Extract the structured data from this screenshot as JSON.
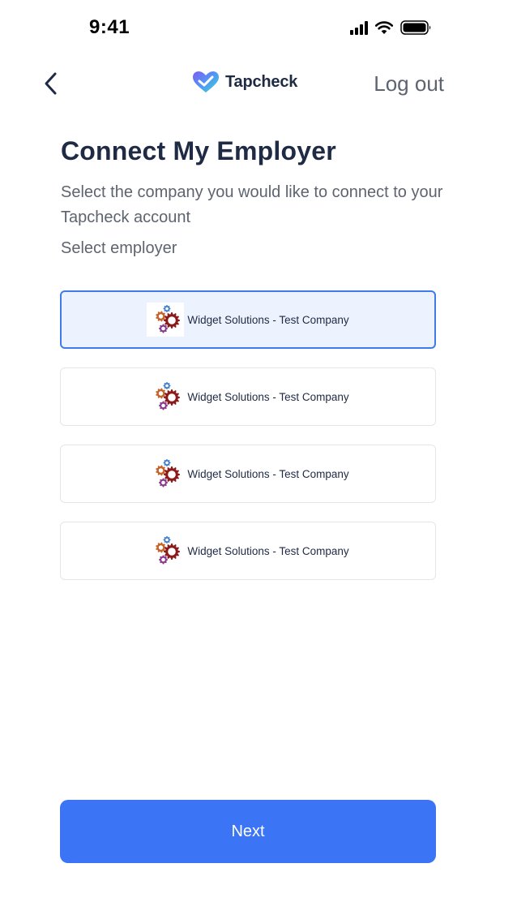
{
  "status_bar": {
    "time": "9:41",
    "icons": [
      "signal-icon",
      "wifi-icon",
      "battery-icon"
    ]
  },
  "nav": {
    "back_icon": "chevron-left-icon",
    "brand_name": "Tapcheck",
    "logout_label": "Log out"
  },
  "page": {
    "title": "Connect My Employer",
    "subtitle": "Select the company you would like to connect to your Tapcheck account",
    "select_label": "Select employer"
  },
  "employers": [
    {
      "name": "Widget Solutions - Test Company",
      "selected": true
    },
    {
      "name": "Widget Solutions - Test Company",
      "selected": false
    },
    {
      "name": "Widget Solutions - Test Company",
      "selected": false
    },
    {
      "name": "Widget Solutions - Test Company",
      "selected": false
    }
  ],
  "actions": {
    "next_label": "Next"
  },
  "colors": {
    "accent": "#3b74f5",
    "selected_border": "#3f7bea",
    "selected_bg": "#edf3fe",
    "title": "#1f2a44",
    "muted": "#5d6470"
  }
}
